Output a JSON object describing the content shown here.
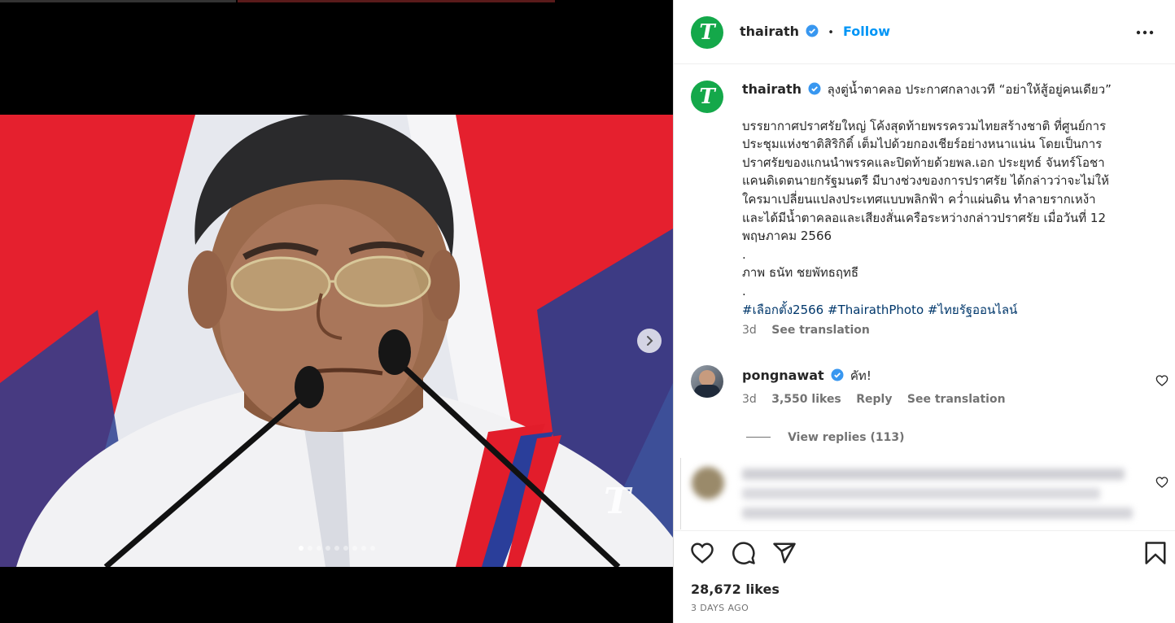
{
  "post": {
    "account": "thairath",
    "follow_label": "Follow",
    "separator": "•",
    "logo_letter": "T"
  },
  "caption": {
    "username": "thairath",
    "headline": "ลุงตู่น้ำตาคลอ ประกาศกลางเวที “อย่าให้สู้อยู่คนเดียว”",
    "lines": [
      "บรรยากาศปราศรัยใหญ่ โค้งสุดท้ายพรรครวมไทยสร้างชาติ ที่ศูนย์การ",
      "ประชุมแห่งชาติสิริกิติ์ เต็มไปด้วยกองเชียร์อย่างหนาแน่น โดยเป็นการ",
      "ปราศรัยของแกนนำพรรคและปิดท้ายด้วยพล.เอก ประยุทธ์ จันทร์โอชา",
      "แคนดิเดตนายกรัฐมนตรี มีบางช่วงของการปราศรัย ได้กล่าวว่าจะไม่ให้",
      "ใครมาเปลี่ยนแปลงประเทศแบบพลิกฟ้า คว่ำแผ่นดิน ทำลายรากเหง้า",
      "และได้มีน้ำตาคลอและเสียงสั่นเครือระหว่างกล่าวปราศรัย เมื่อวันที่ 12",
      "พฤษภาคม 2566"
    ],
    "dot1": ".",
    "photo_credit": "ภาพ ธนัท ชยพัทธฤทธี",
    "dot2": ".",
    "hashtags": [
      "#เลือกตั้ง2566",
      "#ThairathPhoto",
      "#ไทยรัฐออนไลน์"
    ],
    "age": "3d",
    "see_translation": "See translation"
  },
  "comment": {
    "username": "pongnawat",
    "text": "คัท!",
    "age": "3d",
    "likes": "3,550 likes",
    "reply": "Reply",
    "see_translation": "See translation",
    "view_replies": "View replies (113)"
  },
  "footer": {
    "likes": "28,672 likes",
    "date": "3 DAYS AGO"
  },
  "carousel": {
    "slides": 9,
    "active": 1
  },
  "colors": {
    "brand_green": "#14a84a",
    "link_blue": "#0095f6",
    "hashtag_blue": "#00376b",
    "verified_blue": "#3897f0"
  },
  "icons": [
    "verified-icon",
    "more-icon",
    "chevron-right-icon",
    "heart-icon",
    "comment-icon",
    "share-icon",
    "bookmark-icon"
  ]
}
